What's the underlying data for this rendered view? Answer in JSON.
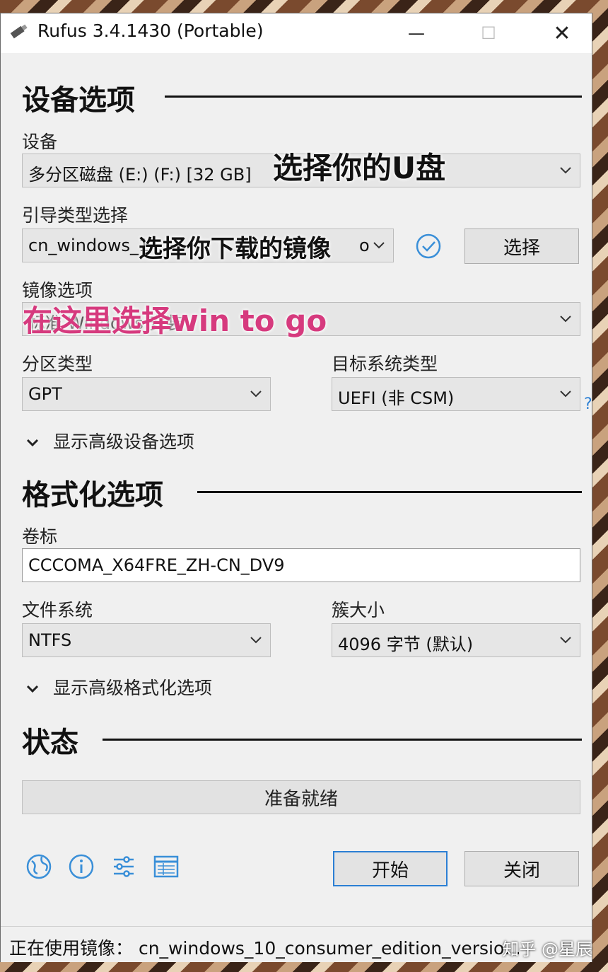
{
  "window": {
    "title": "Rufus 3.4.1430 (Portable)",
    "controls": {
      "minimize": "—",
      "maximize": "☐",
      "close": "✕"
    }
  },
  "device_options": {
    "heading": "设备选项",
    "device_label": "设备",
    "device_value": "多分区磁盘 (E:) (F:) [32 GB]",
    "boot_label": "引导类型选择",
    "boot_value": "cn_windows_1",
    "boot_value_tail": "o",
    "select_button": "选择",
    "image_option_label": "镜像选项",
    "image_option_value": "标准 Windows 安装",
    "partition_label": "分区类型",
    "partition_value": "GPT",
    "target_label": "目标系统类型",
    "target_value": "UEFI (非 CSM)",
    "help": "?",
    "advanced_toggle": "显示高级设备选项"
  },
  "format_options": {
    "heading": "格式化选项",
    "volume_label": "卷标",
    "volume_value": "CCCOMA_X64FRE_ZH-CN_DV9",
    "fs_label": "文件系统",
    "fs_value": "NTFS",
    "cluster_label": "簇大小",
    "cluster_value": "4096 字节 (默认)",
    "advanced_toggle": "显示高级格式化选项"
  },
  "status": {
    "heading": "状态",
    "progress_text": "准备就绪",
    "progress": 0
  },
  "actions": {
    "start": "开始",
    "close": "关闭"
  },
  "footer": {
    "text": "正在使用镜像： cn_windows_10_consumer_edition_versio..."
  },
  "annotations": {
    "usb": "选择你的U盘",
    "image": "选择你下载的镜像",
    "wtg": "在这里选择win to go"
  },
  "watermark": "知乎 @星辰",
  "colors": {
    "accent": "#2b7fd4",
    "overlay_pink": "#d63a7e"
  }
}
